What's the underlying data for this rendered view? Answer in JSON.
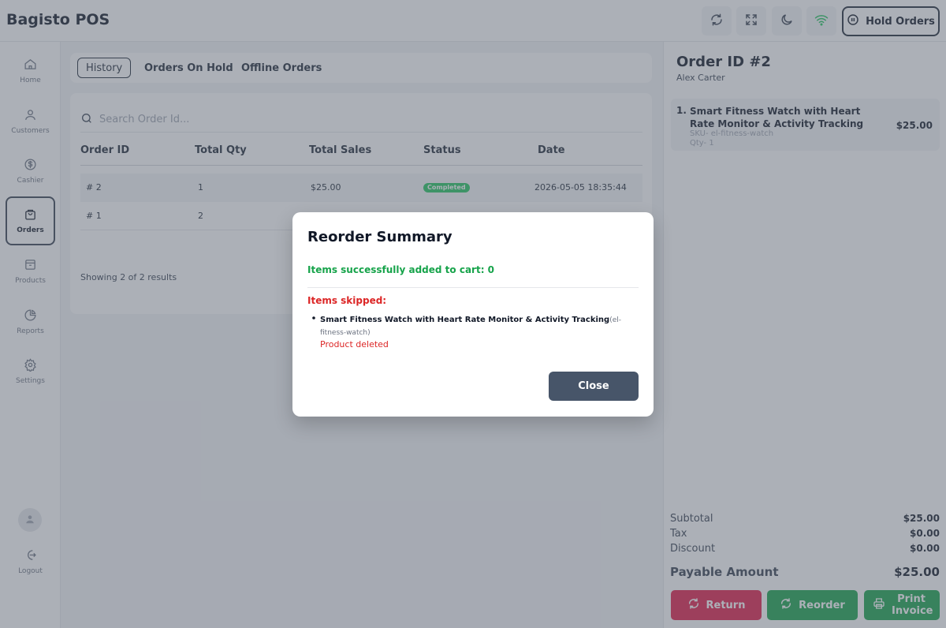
{
  "header": {
    "brand": "Bagisto POS",
    "hold_orders_label": "Hold Orders",
    "icons": [
      "refresh-icon",
      "fullscreen-icon",
      "moon-icon",
      "wifi-icon"
    ]
  },
  "sidebar": {
    "items": [
      {
        "label": "Home",
        "icon": "home-icon"
      },
      {
        "label": "Customers",
        "icon": "user-icon"
      },
      {
        "label": "Cashier",
        "icon": "dollar-icon"
      },
      {
        "label": "Orders",
        "icon": "bag-icon",
        "active": true
      },
      {
        "label": "Products",
        "icon": "box-icon"
      },
      {
        "label": "Reports",
        "icon": "pie-chart-icon"
      },
      {
        "label": "Settings",
        "icon": "gear-icon"
      }
    ],
    "logout_label": "Logout"
  },
  "tabs": [
    "History",
    "Orders On Hold",
    "Offline Orders"
  ],
  "search": {
    "placeholder": "Search Order Id..."
  },
  "table": {
    "columns": [
      "Order ID",
      "Total Qty",
      "Total Sales",
      "Status",
      "Date"
    ],
    "rows": [
      {
        "order_id": "# 2",
        "qty": "1",
        "sales": "$25.00",
        "status": "Completed",
        "date": "2026-05-05 18:35:44"
      },
      {
        "order_id": "# 1",
        "qty": "2"
      }
    ],
    "showing": "Showing 2 of 2 results"
  },
  "order_panel": {
    "title": "Order ID #2",
    "customer": "Alex Carter",
    "item": {
      "index": "1.",
      "name": "Smart Fitness Watch with Heart Rate Monitor & Activity Tracking",
      "sku": "SKU- el-fitness-watch",
      "qty": "Qty- 1",
      "price": "$25.00"
    },
    "totals": {
      "subtotal_label": "Subtotal",
      "subtotal": "$25.00",
      "tax_label": "Tax",
      "tax": "$0.00",
      "discount_label": "Discount",
      "discount": "$0.00",
      "payable_label": "Payable Amount",
      "payable": "$25.00"
    },
    "buttons": {
      "return": "Return",
      "reorder": "Reorder",
      "print": "Print Invoice"
    }
  },
  "modal": {
    "title": "Reorder Summary",
    "success": "Items successfully added to cart: 0",
    "skipped_label": "Items skipped:",
    "skipped_item_name": "Smart Fitness Watch with Heart Rate Monitor & Activity Tracking",
    "skipped_item_sku": "(el-fitness-watch)",
    "skipped_reason": "Product deleted",
    "close_label": "Close"
  },
  "colors": {
    "success": "#16a34a",
    "danger": "#e11d48",
    "badge": "#22c55e",
    "close_button": "#475569"
  }
}
